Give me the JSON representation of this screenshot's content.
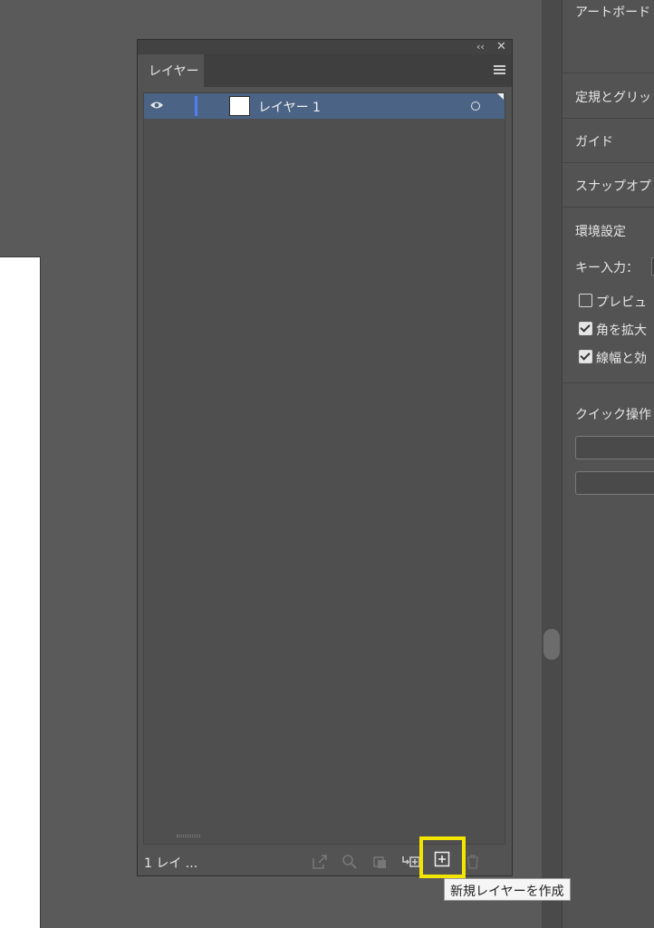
{
  "layers_panel": {
    "tab_label": "レイヤー",
    "layer": {
      "name": "レイヤー 1"
    },
    "footer": {
      "layer_count": "1 レイ ..."
    }
  },
  "tooltip": {
    "text": "新規レイヤーを作成"
  },
  "properties_panel": {
    "artboard": "アートボード",
    "rulers_grid": "定規とグリッ",
    "guides": "ガイド",
    "snap": "スナップオプ",
    "preferences": "環境設定",
    "key_input": "キー入力：",
    "preview_checkbox": {
      "label": "プレビュ",
      "checked": false
    },
    "scale_corners_checkbox": {
      "label": "角を拡大",
      "checked": true
    },
    "scale_strokes_checkbox": {
      "label": "線幅と効",
      "checked": true
    },
    "quick_actions": "クイック操作"
  },
  "icons": {
    "visibility": "eye-icon",
    "panel_menu": "hamburger-menu-icon",
    "collapse": "double-chevron-left-icon",
    "close": "close-icon",
    "export": "export-icon",
    "locate": "search-icon",
    "clipping_mask": "clipping-mask-icon",
    "new_sublayer": "new-sublayer-icon",
    "new_layer": "new-layer-icon",
    "delete": "trash-icon"
  },
  "colors": {
    "selected_row": "#4b6385",
    "layer_color": "#4f7ff0",
    "highlight": "#f2e600"
  }
}
